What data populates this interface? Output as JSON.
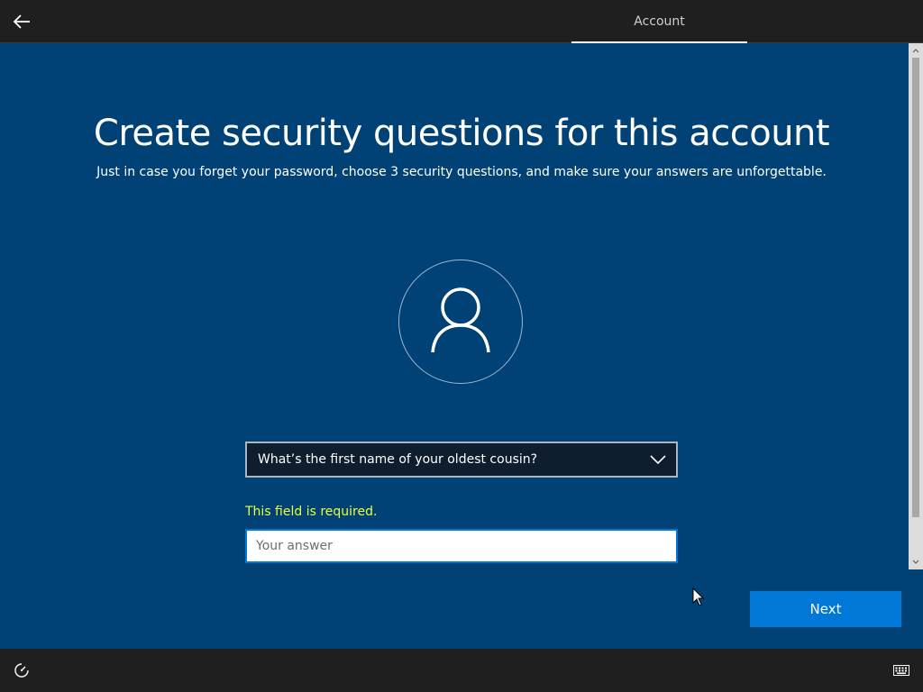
{
  "header": {
    "tab_label": "Account"
  },
  "main": {
    "title": "Create security questions for this account",
    "subtitle": "Just in case you forget your password, choose 3 security questions, and make sure your answers are unforgettable.",
    "question_selected": "What’s the first name of your oldest cousin?",
    "error_text": "This field is required.",
    "answer_placeholder": "Your answer",
    "answer_value": ""
  },
  "footer": {
    "next_label": "Next"
  },
  "icons": {
    "back": "back-arrow-icon",
    "avatar": "user-icon",
    "dropdown": "chevron-down-icon",
    "ease_of_access": "ease-of-access-icon",
    "keyboard": "keyboard-icon"
  },
  "colors": {
    "background": "#004275",
    "accent": "#0078d7",
    "error": "#e8ff3a",
    "topbar": "#1f1f1f"
  }
}
